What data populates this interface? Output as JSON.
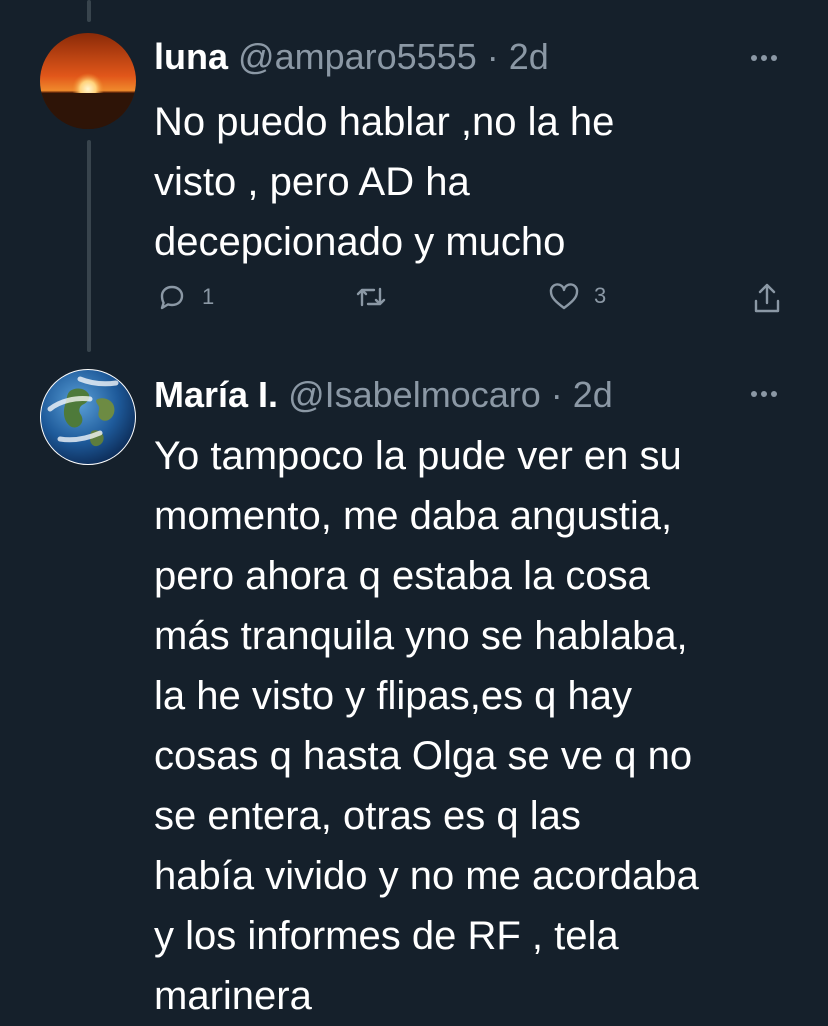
{
  "tweets": [
    {
      "name": "luna",
      "handle": "@amparo5555",
      "separator": "·",
      "time": "2d",
      "text": "No puedo hablar ,no la he\nvisto , pero AD ha\ndecepcionado y mucho",
      "reply_count": "1",
      "retweet_count": "",
      "like_count": "3"
    },
    {
      "name": "María I.",
      "handle": "@Isabelmocaro",
      "separator": "·",
      "time": "2d",
      "text": "Yo tampoco la pude ver en su\nmomento, me daba angustia,\npero ahora q estaba la cosa\nmás tranquila yno se hablaba,\nla he visto y flipas,es q hay\ncosas q hasta Olga se ve q no\nse entera,  otras es q las\nhabía vivido y no me acordaba\ny los informes de RF , tela\nmarinera"
    }
  ],
  "icons": {
    "more": "more-horizontal-icon",
    "reply": "reply-icon",
    "retweet": "retweet-icon",
    "like": "heart-icon",
    "share": "share-icon"
  },
  "colors": {
    "background": "#15202b",
    "text": "#ffffff",
    "secondary_text": "#8b98a5",
    "thread_line": "#38444d"
  }
}
